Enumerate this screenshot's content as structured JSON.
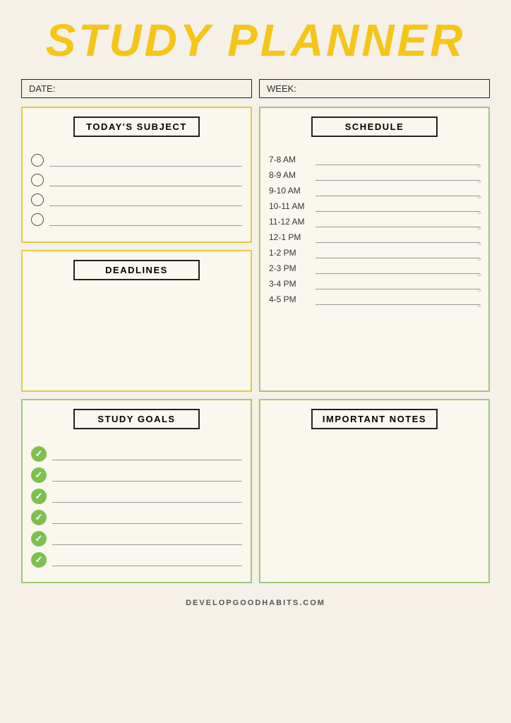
{
  "title": "STUDY PLANNER",
  "date_label": "DATE:",
  "week_label": "WEEK:",
  "sections": {
    "today_subject": {
      "header": "TODAY'S SUBJECT",
      "items": [
        "",
        "",
        "",
        ""
      ]
    },
    "deadlines": {
      "header": "DEADLINES"
    },
    "schedule": {
      "header": "SCHEDULE",
      "time_slots": [
        "7-8 AM",
        "8-9 AM",
        "9-10 AM",
        "10-11 AM",
        "11-12 AM",
        "12-1 PM",
        "1-2 PM",
        "2-3 PM",
        "3-4 PM",
        "4-5 PM"
      ]
    },
    "study_goals": {
      "header": "STUDY GOALS",
      "items": [
        "",
        "",
        "",
        "",
        "",
        ""
      ]
    },
    "important_notes": {
      "header": "IMPORTANT NOTES"
    }
  },
  "footer": "DEVELOPGOODHABITS.COM",
  "colors": {
    "title_yellow": "#f5c518",
    "orange_border": "#e8c840",
    "green_border": "#a0c878",
    "check_green": "#7dc050",
    "background": "#f5f0e8"
  }
}
